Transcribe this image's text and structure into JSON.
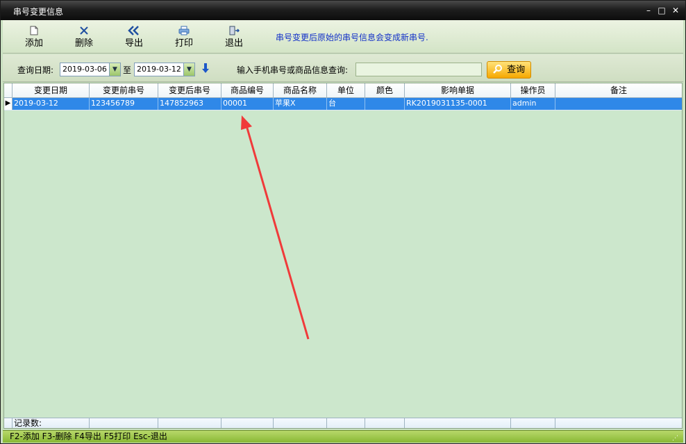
{
  "window": {
    "title": "串号变更信息",
    "minimize": "–",
    "maximize": "□",
    "close": "✕"
  },
  "toolbar": {
    "buttons": [
      {
        "label": "添加",
        "icon": "page-icon"
      },
      {
        "label": "删除",
        "icon": "x-icon"
      },
      {
        "label": "导出",
        "icon": "double-chevron-left-icon"
      },
      {
        "label": "打印",
        "icon": "printer-icon"
      },
      {
        "label": "退出",
        "icon": "exit-door-icon"
      }
    ],
    "hint": "串号变更后原始的串号信息会变成新串号."
  },
  "query": {
    "date_label": "查询日期:",
    "start_date": "2019-03-06",
    "to_label": "至",
    "end_date": "2019-03-12",
    "search_label": "输入手机串号或商品信息查询:",
    "search_value": "",
    "search_button": "查询"
  },
  "grid": {
    "columns": [
      "变更日期",
      "变更前串号",
      "变更后串号",
      "商品编号",
      "商品名称",
      "单位",
      "颜色",
      "影响单据",
      "操作员",
      "备注"
    ],
    "rows": [
      [
        "2019-03-12",
        "123456789",
        "147852963",
        "00001",
        "苹果X",
        "台",
        "",
        "RK2019031135-0001",
        "admin",
        ""
      ]
    ],
    "footer_label": "记录数:"
  },
  "statusbar": {
    "shortcuts": "F2-添加 F3-删除 F4导出 F5打印 Esc-退出"
  },
  "colors": {
    "accent": "#2f88e8",
    "background": "#cce7cc",
    "annotation_arrow": "#f03a3a",
    "hint": "#1230c8"
  }
}
